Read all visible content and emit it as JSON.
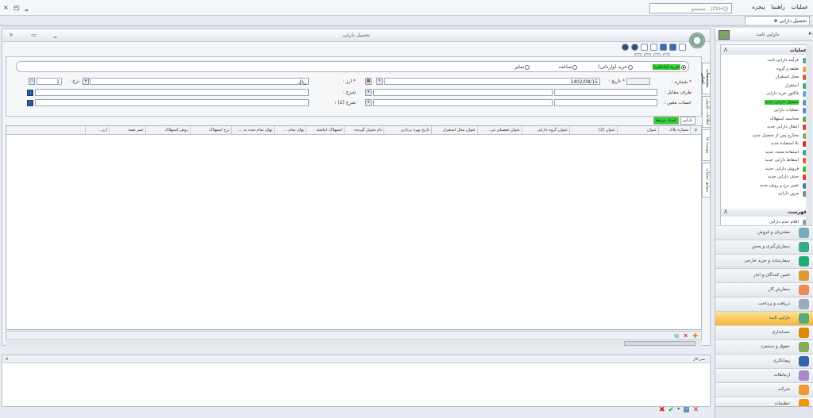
{
  "menubar": {
    "window_controls": "× ◰ ‗",
    "search_placeholder": "جستجو... (Ctrl+Q)",
    "menus": [
      "عملیات",
      "راهنما",
      "پنجره"
    ]
  },
  "doc_tab": {
    "label": "تحصیل دارایی"
  },
  "main": {
    "title": "تحصیل دارایی",
    "window_controls": "× ▭ ‗",
    "radio_options": [
      {
        "label": "خرید (داخلی)",
        "selected": true
      },
      {
        "label": "خرید (وارداتی)",
        "selected": false
      },
      {
        "label": "ساخت",
        "selected": false
      },
      {
        "label": "سایر",
        "selected": false
      }
    ],
    "form": {
      "number_label": "شماره :",
      "date_label": "تاریخ :",
      "date_value": "1402/08/15",
      "currency_label": "ارز :",
      "currency_value": "ریال",
      "rate_label": "نرخ :",
      "rate_value": "1",
      "counterparty_label": "طرف مقابل :",
      "description_label": "شرح :",
      "account_label": "حساب معین :",
      "description2_label": "شرح (2) :"
    },
    "grid_tabs": [
      "دارایی",
      "اسناد مرتبط"
    ],
    "grid_columns": [
      "شماره پلاک",
      "عنوان",
      "عنوان (2)",
      "عنوان گروه دارایی",
      "عنوان تفصیلی مر...",
      "عنوان محل استقرار",
      "تاریخ بهره برداری",
      "نام تحویل گیرنده",
      "استهلاک انباشته",
      "بهای تمام ...",
      "بهای تمام شده به ...",
      "نرخ استهلاک",
      "روش استهلاک",
      "عمر مفید",
      "ارز..."
    ],
    "side_tabs": [
      "مشخصات اصلی",
      "اطلاعات تکمیلی",
      "پیوست ها",
      "سوابق عملیات"
    ]
  },
  "workspace": {
    "title": "میز کار",
    "pin": "ᵰ"
  },
  "right_panel": {
    "title": "دارایی ثابت",
    "pin": "ᵰ",
    "operations_header": "عملیات",
    "operations": [
      "فرآیند دارایی ثابت",
      "طبقه و گروه",
      "محل استقرار",
      "استقرار",
      "فاکتور خرید دارایی",
      "تحصیل دارایی جدید",
      "عملیات دارایی",
      "محاسبه استهلاک",
      "انتقال دارایی جدید",
      "مخارج پس از تحصیل جدید",
      "بلا استفاده جدید",
      "استفاده مجدد جدید",
      "اسقاط دارایی جدید",
      "فروش دارایی جدید",
      "حذف دارایی جدید",
      "تغییر نرخ و روش جدید",
      "مرور دارایی"
    ],
    "selected_operation": 5,
    "list_header": "فهرست",
    "list_first": "اقلام خدم دارایی",
    "modules": [
      "مشتریان و فروش",
      "سفارش‌گیری و پخش",
      "سفارشات و خرید خارجی",
      "تامین کنندگان و انبار",
      "سفارش کار",
      "دریافت و پرداخت",
      "دارایی ثابت",
      "حسابداری",
      "حقوق و دستمزد",
      "پیمانکاری",
      "ارتباطات",
      "شرکت",
      "تنظیمات"
    ],
    "active_module": 6,
    "colors": {
      "highlight": "#2fd12f",
      "active_module": "#f3b634"
    }
  }
}
